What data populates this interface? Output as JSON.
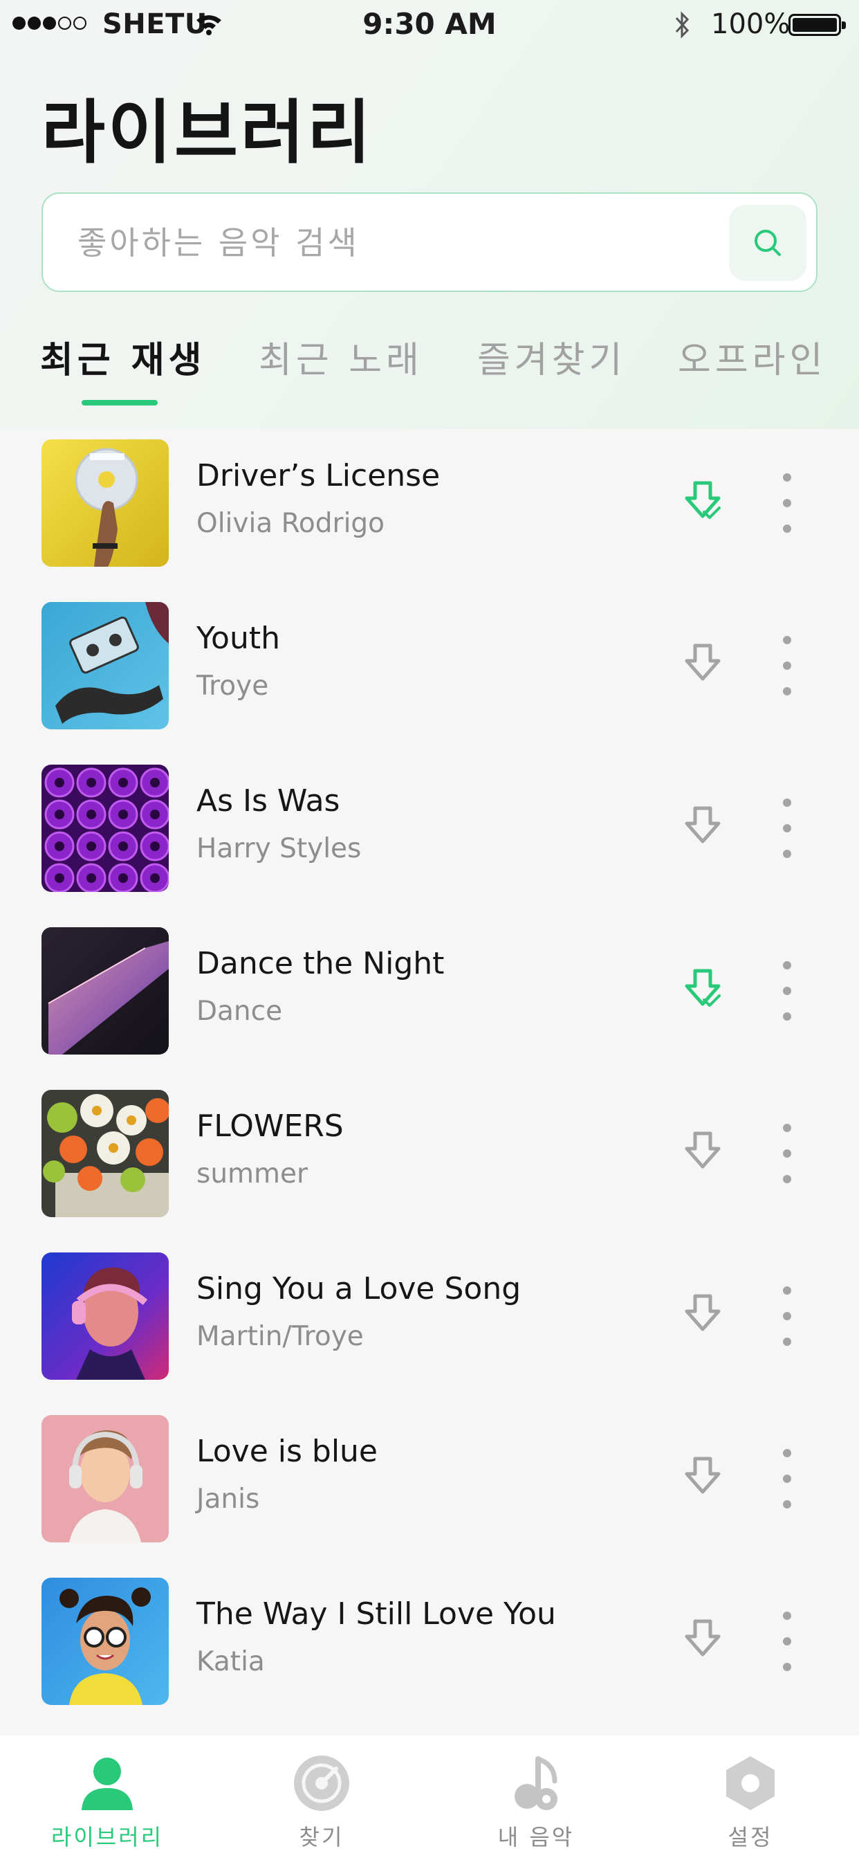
{
  "colors": {
    "accent": "#29c97a",
    "muted": "#a4a4a4",
    "background": "#f6f6f6"
  },
  "status_bar": {
    "carrier": "SHETU",
    "time": "9:30 AM",
    "battery": "100%",
    "signal_bars_filled": 3,
    "signal_bars_total": 5
  },
  "page": {
    "title": "라이브러리"
  },
  "search": {
    "placeholder": "좋아하는 음악 검색",
    "value": "",
    "icon": "search-icon"
  },
  "tabs": [
    {
      "label": "최근 재생",
      "active": true
    },
    {
      "label": "최근 노래",
      "active": false
    },
    {
      "label": "즐겨찾기",
      "active": false
    },
    {
      "label": "오프라인",
      "active": false
    }
  ],
  "songs": [
    {
      "title": "Driver’s License",
      "artist": "Olivia Rodrigo",
      "downloaded": true,
      "cover": "cd-in-hand-on-yellow"
    },
    {
      "title": "Youth",
      "artist": "Troye",
      "downloaded": false,
      "cover": "cassette-on-blue"
    },
    {
      "title": "As Is Was",
      "artist": "Harry Styles",
      "downloaded": false,
      "cover": "purple-speakers"
    },
    {
      "title": "Dance the Night",
      "artist": "Dance",
      "downloaded": true,
      "cover": "dark-pink-gradient"
    },
    {
      "title": "FLOWERS",
      "artist": "summer",
      "downloaded": false,
      "cover": "flower-bouquet"
    },
    {
      "title": "Sing You a Love Song",
      "artist": "Martin/Troye",
      "downloaded": false,
      "cover": "man-with-headphones-neon"
    },
    {
      "title": "Love is blue",
      "artist": "Janis",
      "downloaded": false,
      "cover": "boy-with-headphones-pink"
    },
    {
      "title": "The Way I Still Love You",
      "artist": "Katia",
      "downloaded": false,
      "cover": "woman-sunglasses-yellow"
    }
  ],
  "tab_bar": [
    {
      "label": "라이브러리",
      "icon": "person-icon",
      "active": true
    },
    {
      "label": "찾기",
      "icon": "disc-icon",
      "active": false
    },
    {
      "label": "내 음악",
      "icon": "music-note-icon",
      "active": false
    },
    {
      "label": "설정",
      "icon": "hexagon-settings-icon",
      "active": false
    }
  ]
}
